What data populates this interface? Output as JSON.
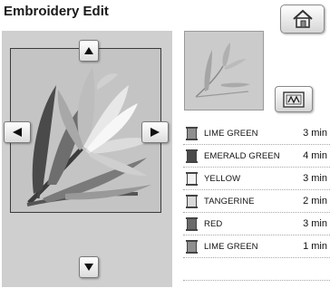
{
  "screen": {
    "title": "Embroidery Edit"
  },
  "buttons": {
    "home_icon": "home-icon",
    "scan_icon": "frame-scan-icon",
    "up_icon": "arrow-up-icon",
    "down_icon": "arrow-down-icon",
    "left_icon": "arrow-left-icon",
    "right_icon": "arrow-right-icon"
  },
  "thread_colors": [
    {
      "name": "LIME GREEN",
      "time": "3 min",
      "swatch": "#8f8f8f"
    },
    {
      "name": "EMERALD GREEN",
      "time": "4 min",
      "swatch": "#4a4a4a"
    },
    {
      "name": "YELLOW",
      "time": "3 min",
      "swatch": "#f3f3f3"
    },
    {
      "name": "TANGERINE",
      "time": "2 min",
      "swatch": "#d9d9d9"
    },
    {
      "name": "RED",
      "time": "3 min",
      "swatch": "#6a6a6a"
    },
    {
      "name": "LIME GREEN",
      "time": "1 min",
      "swatch": "#8f8f8f"
    }
  ]
}
